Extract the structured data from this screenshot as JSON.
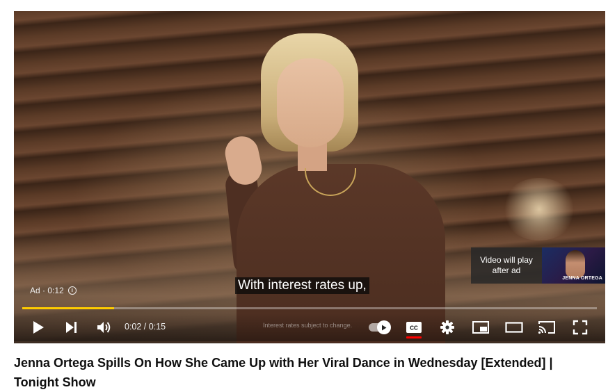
{
  "player": {
    "ad_label": "Ad · 0:12",
    "caption": "With interest rates up,",
    "up_next": {
      "line1": "Video will play",
      "line2": "after ad",
      "thumbnail_name": "JENNA ORTEGA"
    },
    "progress": 0.16,
    "progress_color": "#ffcc00",
    "controls": {
      "time": "0:02 / 0:15",
      "disclaimer": "Interest rates subject to change.",
      "icons": [
        "play-icon",
        "next-icon",
        "volume-icon",
        "autoplay-toggle",
        "subtitles-icon",
        "settings-icon",
        "miniplayer-icon",
        "theater-icon",
        "cast-icon",
        "fullscreen-icon"
      ],
      "cc_underline_color": "#ff0000"
    }
  },
  "video": {
    "title": "Jenna Ortega Spills On How She Came Up with Her Viral Dance in Wednesday [Extended] | Tonight Show"
  }
}
